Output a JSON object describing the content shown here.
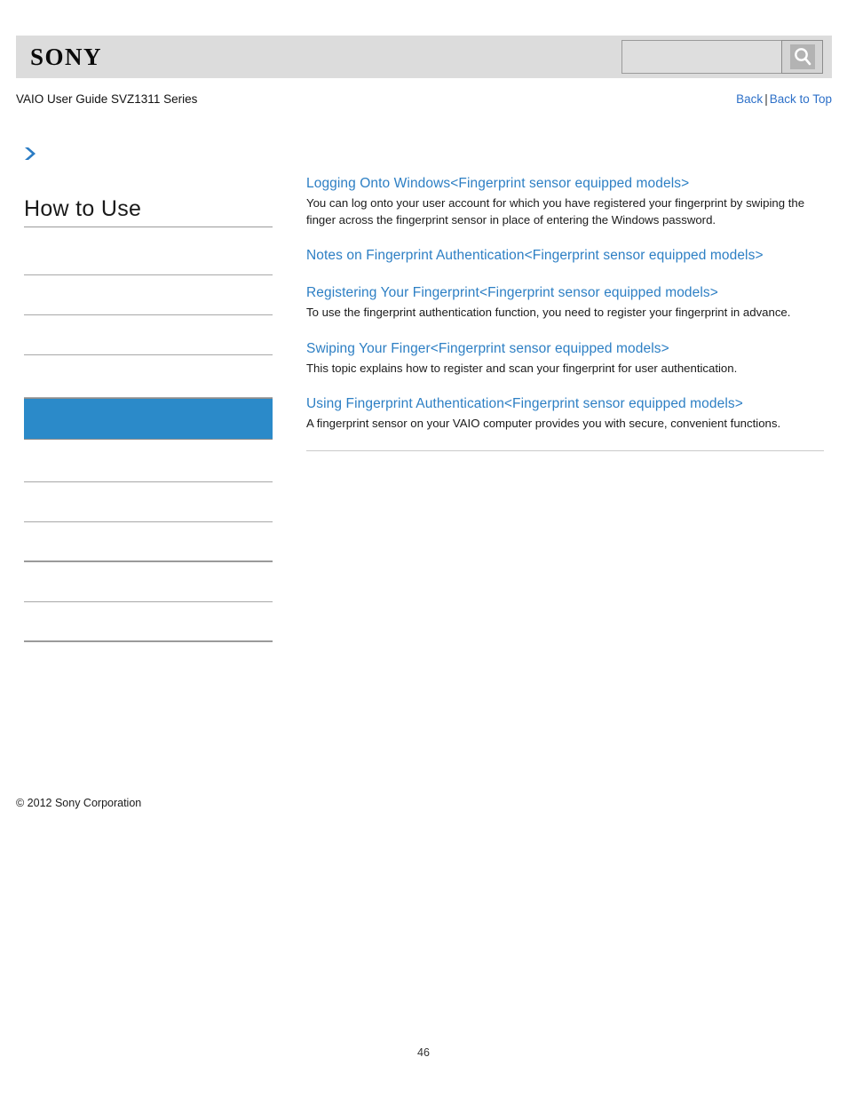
{
  "header": {
    "logo_text": "SONY",
    "search": {
      "value": "",
      "placeholder": "",
      "button_icon": "search-icon"
    }
  },
  "subheader": {
    "guide_title": "VAIO User Guide SVZ1311 Series",
    "back_label": "Back",
    "separator": "|",
    "back_to_top_label": "Back to Top"
  },
  "sidebar": {
    "breadcrumb_icon": "chevron-right-icon",
    "section_title": "How to Use",
    "items": [
      {
        "label": "",
        "active": false,
        "thick": false
      },
      {
        "label": "",
        "active": false,
        "thick": false
      },
      {
        "label": "",
        "active": false,
        "thick": false
      },
      {
        "label": "",
        "active": false,
        "thick": false
      },
      {
        "label": "",
        "active": true,
        "thick": false
      },
      {
        "label": "",
        "active": false,
        "thick": false
      },
      {
        "label": "",
        "active": false,
        "thick": false
      },
      {
        "label": "",
        "active": false,
        "thick": true
      },
      {
        "label": "",
        "active": false,
        "thick": false
      },
      {
        "label": "",
        "active": false,
        "thick": true
      }
    ],
    "copyright": "© 2012 Sony Corporation"
  },
  "content": {
    "topics": [
      {
        "link": "Logging Onto Windows<Fingerprint sensor equipped models>",
        "description": "You can log onto your user account for which you have registered your fingerprint by swiping the finger across the fingerprint sensor in place of entering the Windows password."
      },
      {
        "link": "Notes on Fingerprint Authentication<Fingerprint sensor equipped models>",
        "description": ""
      },
      {
        "link": "Registering Your Fingerprint<Fingerprint sensor equipped models>",
        "description": "To use the fingerprint authentication function, you need to register your fingerprint in advance."
      },
      {
        "link": "Swiping Your Finger<Fingerprint sensor equipped models>",
        "description": "This topic explains how to register and scan your fingerprint for user authentication."
      },
      {
        "link": "Using Fingerprint Authentication<Fingerprint sensor equipped models>",
        "description": "A fingerprint sensor on your VAIO computer provides you with secure, convenient functions."
      }
    ]
  },
  "footer": {
    "page_number": "46"
  },
  "colors": {
    "link_blue": "#2d7fc4",
    "accent_blue": "#2b8ac9",
    "header_gray": "#dcdcdc",
    "rule_gray": "#a8a8a8"
  }
}
